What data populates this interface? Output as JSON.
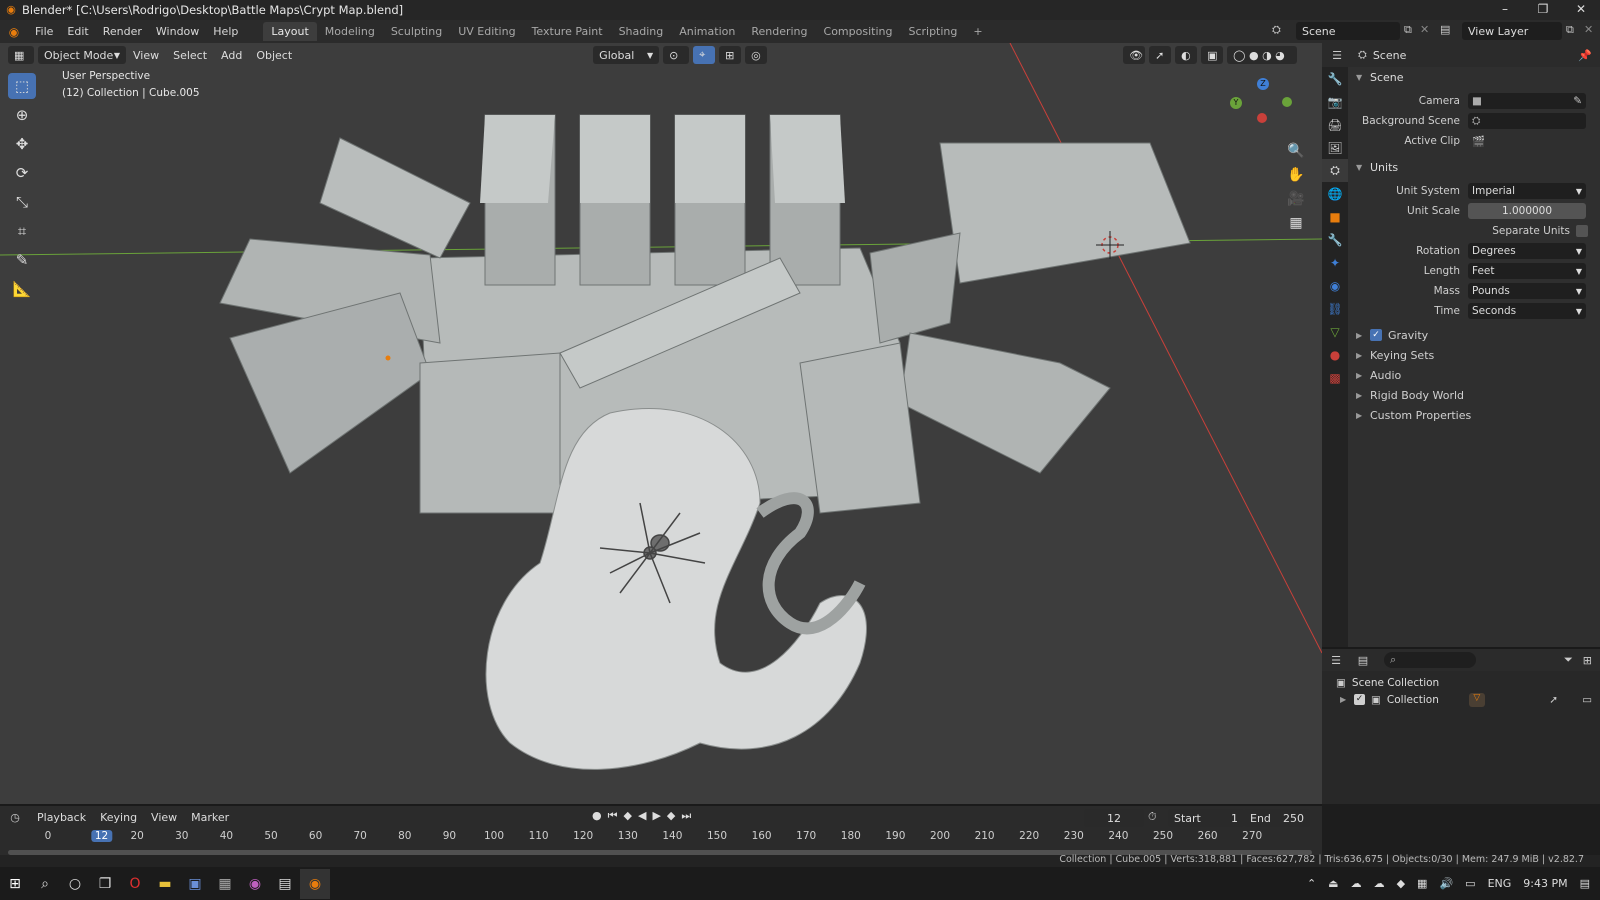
{
  "window": {
    "title": "Blender* [C:\\Users\\Rodrigo\\Desktop\\Battle Maps\\Crypt Map.blend]",
    "minimize": "–",
    "maximize": "❐",
    "close": "✕"
  },
  "menu": [
    "File",
    "Edit",
    "Render",
    "Window",
    "Help"
  ],
  "workspaces": [
    "Layout",
    "Modeling",
    "Sculpting",
    "UV Editing",
    "Texture Paint",
    "Shading",
    "Animation",
    "Rendering",
    "Compositing",
    "Scripting"
  ],
  "add_workspace": "+",
  "scene_name": "Scene",
  "view_layer_name": "View Layer",
  "viewport": {
    "mode": "Object Mode",
    "menus": [
      "View",
      "Select",
      "Add",
      "Object"
    ],
    "orientation": "Global",
    "perspective": "User Perspective",
    "collection_info": "(12) Collection | Cube.005",
    "gizmo": {
      "z": "Z",
      "y": "Y"
    }
  },
  "properties": {
    "header_title": "Scene",
    "scene_panel": "Scene",
    "camera_label": "Camera",
    "background_scene_label": "Background Scene",
    "active_clip_label": "Active Clip",
    "units_panel": "Units",
    "unit_system_label": "Unit System",
    "unit_system_value": "Imperial",
    "unit_scale_label": "Unit Scale",
    "unit_scale_value": "1.000000",
    "separate_units_label": "Separate Units",
    "rotation_label": "Rotation",
    "rotation_value": "Degrees",
    "length_label": "Length",
    "length_value": "Feet",
    "mass_label": "Mass",
    "mass_value": "Pounds",
    "time_label": "Time",
    "time_value": "Seconds",
    "gravity_label": "Gravity",
    "keying_sets_label": "Keying Sets",
    "audio_label": "Audio",
    "rigid_body_label": "Rigid Body World",
    "custom_props_label": "Custom Properties"
  },
  "outliner": {
    "scene_collection": "Scene Collection",
    "collection": "Collection"
  },
  "timeline": {
    "menus": [
      "Playback",
      "Keying",
      "View",
      "Marker"
    ],
    "current_frame": "12",
    "start_label": "Start",
    "start_value": "1",
    "end_label": "End",
    "end_value": "250",
    "frame_ticks": [
      "0",
      "12",
      "20",
      "30",
      "40",
      "50",
      "60",
      "70",
      "80",
      "90",
      "100",
      "110",
      "120",
      "130",
      "140",
      "150",
      "160",
      "170",
      "180",
      "190",
      "200",
      "210",
      "220",
      "230",
      "240",
      "250",
      "260",
      "270"
    ]
  },
  "status": "Collection | Cube.005 | Verts:318,881 | Faces:627,782 | Tris:636,675 | Objects:0/30 | Mem: 247.9 MiB | v2.82.7",
  "taskbar": {
    "lang": "ENG",
    "time": "9:43 PM"
  },
  "colors": {
    "accent": "#4772b3",
    "blender_orange": "#e87d0d",
    "x_axis": "#c9403a",
    "y_axis": "#6aa33a",
    "z_axis": "#3f7fd6"
  }
}
